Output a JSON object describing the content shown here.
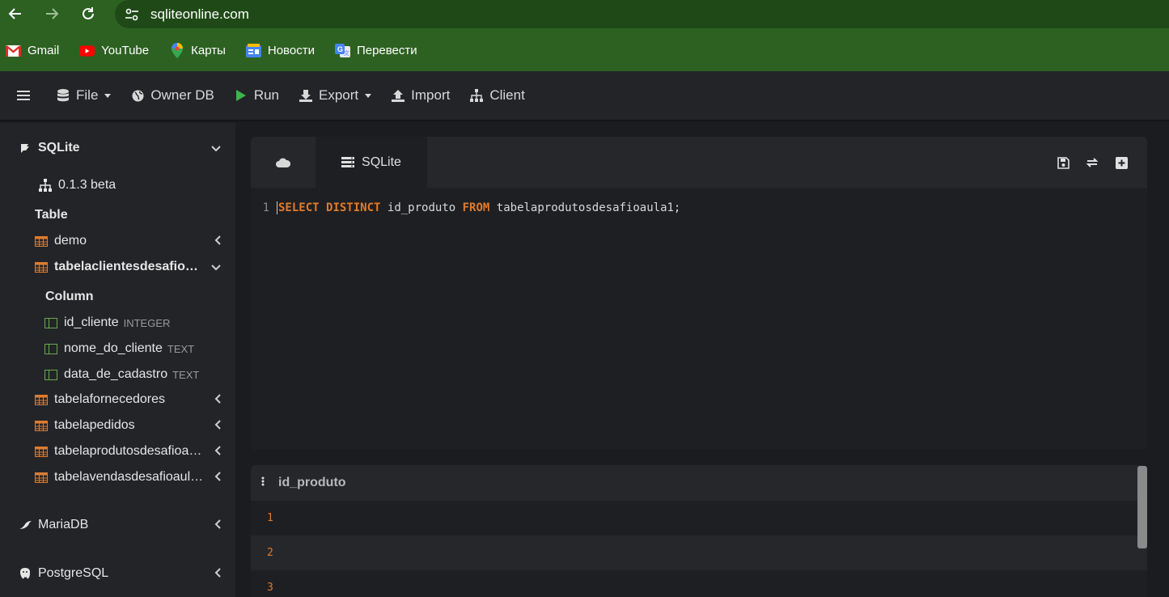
{
  "browser": {
    "url": "sqliteonline.com",
    "bookmarks": [
      {
        "label": "Gmail",
        "icon": "gmail-icon"
      },
      {
        "label": "YouTube",
        "icon": "youtube-icon"
      },
      {
        "label": "Карты",
        "icon": "maps-icon"
      },
      {
        "label": "Новости",
        "icon": "news-icon"
      },
      {
        "label": "Перевести",
        "icon": "translate-icon"
      }
    ]
  },
  "toolbar": {
    "file": "File",
    "owner_db": "Owner DB",
    "run": "Run",
    "export": "Export",
    "import": "Import",
    "client": "Client"
  },
  "sidebar": {
    "sqlite": "SQLite",
    "version": "0.1.3 beta",
    "table_heading": "Table",
    "tables": [
      "demo",
      "tabelaclientesdesafio…",
      "tabelafornecedores",
      "tabelapedidos",
      "tabelaprodutosdesafioa…",
      "tabelavendasdesafioaul…"
    ],
    "column_heading": "Column",
    "columns": [
      {
        "name": "id_cliente",
        "type": "INTEGER"
      },
      {
        "name": "nome_do_cliente",
        "type": "TEXT"
      },
      {
        "name": "data_de_cadastro",
        "type": "TEXT"
      }
    ],
    "mariadb": "MariaDB",
    "postgresql": "PostgreSQL"
  },
  "editor": {
    "tab_label": "SQLite",
    "line_number": "1",
    "code": {
      "kw1": "SELECT",
      "kw2": "DISTINCT",
      "col": "id_produto",
      "kw3": "FROM",
      "table": "tabelaprodutosdesafioaula1;"
    }
  },
  "results": {
    "column": "id_produto",
    "rows": [
      "1",
      "2",
      "3"
    ]
  },
  "colors": {
    "browser_green": "#2d6122",
    "accent_orange": "#e07b2c",
    "column_green": "#6aa84f",
    "run_green": "#3bb54a"
  }
}
